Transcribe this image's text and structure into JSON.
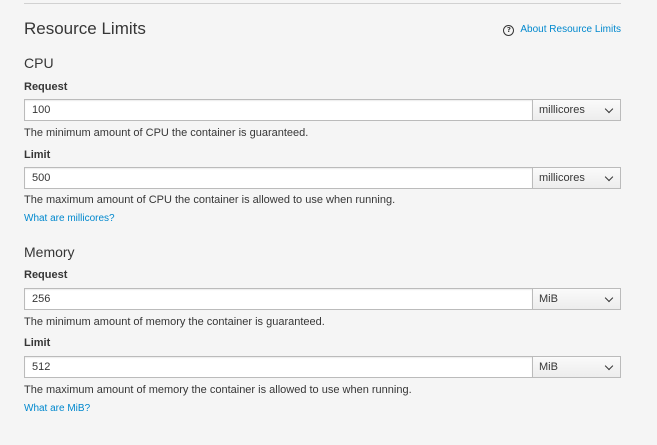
{
  "resource_limits": {
    "title": "Resource Limits",
    "about_link": "About Resource Limits"
  },
  "cpu": {
    "title": "CPU",
    "request": {
      "label": "Request",
      "value": "100",
      "unit": "millicores",
      "help": "The minimum amount of CPU the container is guaranteed."
    },
    "limit": {
      "label": "Limit",
      "value": "500",
      "unit": "millicores",
      "help": "The maximum amount of CPU the container is allowed to use when running."
    },
    "info_link": "What are millicores?"
  },
  "memory": {
    "title": "Memory",
    "request": {
      "label": "Request",
      "value": "256",
      "unit": "MiB",
      "help": "The minimum amount of memory the container is guaranteed."
    },
    "limit": {
      "label": "Limit",
      "value": "512",
      "unit": "MiB",
      "help": "The maximum amount of memory the container is allowed to use when running."
    },
    "info_link": "What are MiB?"
  },
  "colors": {
    "background": "#f5f5f5",
    "link": "#0088ce",
    "text": "#363636",
    "border": "#bbbbbb"
  },
  "icons": {
    "help": "question-circle-icon",
    "select": "chevron-down-icon"
  }
}
